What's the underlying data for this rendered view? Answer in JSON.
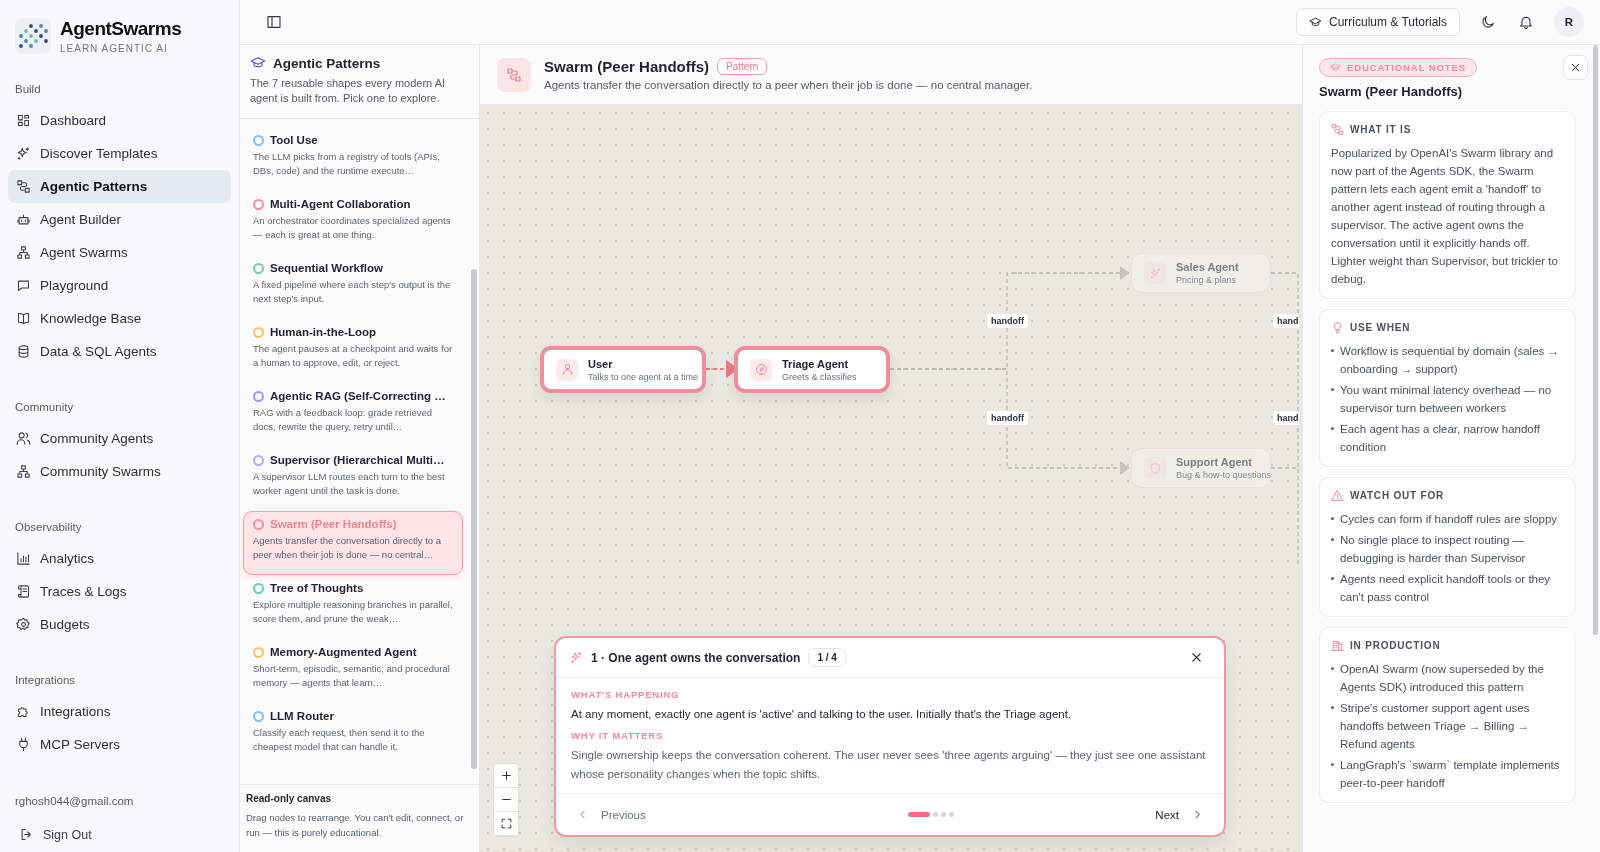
{
  "brand": {
    "name": "AgentSwarms",
    "tagline": "LEARN AGENTIC AI"
  },
  "nav": [
    {
      "heading": "Build",
      "items": [
        {
          "label": "Dashboard",
          "selected": false
        },
        {
          "label": "Discover Templates",
          "selected": false
        },
        {
          "label": "Agentic Patterns",
          "selected": true
        },
        {
          "label": "Agent Builder",
          "selected": false
        },
        {
          "label": "Agent Swarms",
          "selected": false
        },
        {
          "label": "Playground",
          "selected": false
        },
        {
          "label": "Knowledge Base",
          "selected": false
        },
        {
          "label": "Data & SQL Agents",
          "selected": false
        }
      ]
    },
    {
      "heading": "Community",
      "items": [
        {
          "label": "Community Agents",
          "selected": false
        },
        {
          "label": "Community Swarms",
          "selected": false
        }
      ]
    },
    {
      "heading": "Observability",
      "items": [
        {
          "label": "Analytics",
          "selected": false
        },
        {
          "label": "Traces & Logs",
          "selected": false
        },
        {
          "label": "Budgets",
          "selected": false
        }
      ]
    },
    {
      "heading": "Integrations",
      "items": [
        {
          "label": "Integrations",
          "selected": false
        },
        {
          "label": "MCP Servers",
          "selected": false
        }
      ]
    }
  ],
  "account": {
    "email": "rghosh044@gmail.com",
    "sign_out": "Sign Out"
  },
  "topbar": {
    "curriculum_button": "Curriculum & Tutorials",
    "avatar": "R"
  },
  "patterns_panel": {
    "title": "Agentic Patterns",
    "subtitle": "The 7 reusable shapes every modern AI agent is built from. Pick one to explore.",
    "items": [
      {
        "name": "Tool Use",
        "description": "The LLM picks from a registry of tools (APIs, DBs, code) and the runtime execute…",
        "color": "#7cc4f0",
        "selected": false
      },
      {
        "name": "Multi-Agent Collaboration",
        "description": "An orchestrator coordinates specialized agents — each is great at one thing.",
        "color": "#f0909e",
        "selected": false
      },
      {
        "name": "Sequential Workflow",
        "description": "A fixed pipeline where each step's output is the next step's input.",
        "color": "#6fd3a6",
        "selected": false
      },
      {
        "name": "Human-in-the-Loop",
        "description": "The agent pauses at a checkpoint and waits for a human to approve, edit, or reject.",
        "color": "#f3c85a",
        "selected": false
      },
      {
        "name": "Agentic RAG (Self-Correcting …",
        "description": "RAG with a feedback loop: grade retrieved docs, rewrite the query, retry until…",
        "color": "#9a9cf0",
        "selected": false
      },
      {
        "name": "Supervisor (Hierarchical Multi…",
        "description": "A supervisor LLM routes each turn to the best worker agent until the task is done.",
        "color": "#bba8f2",
        "selected": false
      },
      {
        "name": "Swarm (Peer Handoffs)",
        "description": "Agents transfer the conversation directly to a peer when their job is done — no central…",
        "color": "#f0909e",
        "selected": true
      },
      {
        "name": "Tree of Thoughts",
        "description": "Explore multiple reasoning branches in parallel, score them, and prune the weak…",
        "color": "#5fd0c0",
        "selected": false
      },
      {
        "name": "Memory-Augmented Agent",
        "description": "Short-term, episodic, semantic, and procedural memory — agents that learn…",
        "color": "#f3c85a",
        "selected": false
      },
      {
        "name": "LLM Router",
        "description": "Classify each request, then send it to the cheapest model that can handle it.",
        "color": "#7cc4f0",
        "selected": false
      }
    ],
    "footer": {
      "title": "Read-only canvas",
      "text": "Drag nodes to rearrange. You can't edit, connect, or run — this is purely educational."
    }
  },
  "pattern_header": {
    "title": "Swarm (Peer Handoffs)",
    "badge": "Pattern",
    "description": "Agents transfer the conversation directly to a peer when their job is done — no central manager."
  },
  "canvas": {
    "nodes": [
      {
        "title": "User",
        "subtitle": "Talks to one agent at a time",
        "active": true
      },
      {
        "title": "Triage Agent",
        "subtitle": "Greets & classifies",
        "active": true
      },
      {
        "title": "Sales Agent",
        "subtitle": "Pricing & plans",
        "active": false
      },
      {
        "title": "Support Agent",
        "subtitle": "Bug & how-to questions",
        "active": false
      }
    ],
    "edges": [
      {
        "active": true
      },
      {
        "label": "handoff",
        "active": false
      },
      {
        "label": "handoff",
        "active": false
      },
      {
        "label": "hand",
        "active": false
      },
      {
        "label": "hand",
        "active": false
      }
    ]
  },
  "tour": {
    "title": "1 · One agent owns the conversation",
    "counter": "1 / 4",
    "sections": [
      {
        "heading": "WHAT'S HAPPENING",
        "text": "At any moment, exactly one agent is 'active' and talking to the user. Initially that's the Triage agent.",
        "emphasis": true
      },
      {
        "heading": "WHY IT MATTERS",
        "text": "Single ownership keeps the conversation coherent. The user never sees 'three agents arguing' — they just see one assistant whose personality changes when the topic shifts.",
        "emphasis": false
      }
    ],
    "previous": "Previous",
    "next": "Next",
    "steps": [
      {
        "selected": true
      },
      {
        "selected": false
      },
      {
        "selected": false
      },
      {
        "selected": false
      }
    ]
  },
  "notes": {
    "badge": "EDUCATIONAL NOTES",
    "title": "Swarm (Peer Handoffs)",
    "sections": [
      {
        "kind": "paragraph",
        "heading": "WHAT IT IS",
        "text": "Popularized by OpenAI's Swarm library and now part of the Agents SDK, the Swarm pattern lets each agent emit a 'handoff' to another agent instead of routing through a supervisor. The active agent owns the conversation until it explicitly hands off. Lighter weight than Supervisor, but trickier to debug."
      },
      {
        "kind": "list",
        "heading": "USE WHEN",
        "bullets": [
          "Workflow is sequential by domain (sales → onboarding → support)",
          "You want minimal latency overhead — no supervisor turn between workers",
          "Each agent has a clear, narrow handoff condition"
        ]
      },
      {
        "kind": "list",
        "heading": "WATCH OUT FOR",
        "bullets": [
          "Cycles can form if handoff rules are sloppy",
          "No single place to inspect routing — debugging is harder than Supervisor",
          "Agents need explicit handoff tools or they can't pass control"
        ]
      },
      {
        "kind": "list",
        "heading": "IN PRODUCTION",
        "bullets": [
          "OpenAI Swarm (now superseded by the Agents SDK) introduced this pattern",
          "Stripe's customer support agent uses handoffs between Triage → Billing → Refund agents",
          "LangGraph's `swarm` template implements peer-to-peer handoff"
        ]
      }
    ]
  }
}
